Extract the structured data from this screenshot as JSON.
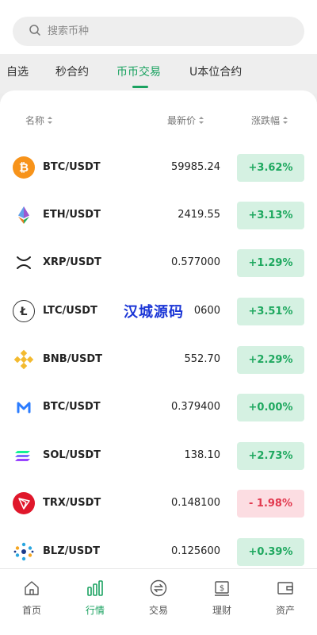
{
  "search": {
    "placeholder": "搜索币种"
  },
  "tabs": [
    {
      "label": "自选"
    },
    {
      "label": "秒合约"
    },
    {
      "label": "币币交易"
    },
    {
      "label": "U本位合约"
    }
  ],
  "active_tab": "币币交易",
  "columns": {
    "name": "名称",
    "price": "最新价",
    "change": "涨跌幅"
  },
  "rows": [
    {
      "pair": "BTC/USDT",
      "price": "59985.24",
      "change": "+3.62%",
      "direction": "up",
      "icon": "bitcoin-icon"
    },
    {
      "pair": "ETH/USDT",
      "price": "2419.55",
      "change": "+3.13%",
      "direction": "up",
      "icon": "ethereum-icon"
    },
    {
      "pair": "XRP/USDT",
      "price": "0.577000",
      "change": "+1.29%",
      "direction": "up",
      "icon": "xrp-icon"
    },
    {
      "pair": "LTC/USDT",
      "price": "0600",
      "change": "+3.51%",
      "direction": "up",
      "icon": "litecoin-icon"
    },
    {
      "pair": "BNB/USDT",
      "price": "552.70",
      "change": "+2.29%",
      "direction": "up",
      "icon": "bnb-icon"
    },
    {
      "pair": "BTC/USDT",
      "price": "0.379400",
      "change": "+0.00%",
      "direction": "up",
      "icon": "m-logo-icon"
    },
    {
      "pair": "SOL/USDT",
      "price": "138.10",
      "change": "+2.73%",
      "direction": "up",
      "icon": "solana-icon"
    },
    {
      "pair": "TRX/USDT",
      "price": "0.148100",
      "change": "- 1.98%",
      "direction": "down",
      "icon": "tron-icon"
    },
    {
      "pair": "BLZ/USDT",
      "price": "0.125600",
      "change": "+0.39%",
      "direction": "up",
      "icon": "bluzelle-icon"
    }
  ],
  "watermark": "汉城源码",
  "nav": [
    {
      "label": "首页",
      "icon": "home-icon"
    },
    {
      "label": "行情",
      "icon": "market-chart-icon"
    },
    {
      "label": "交易",
      "icon": "exchange-icon"
    },
    {
      "label": "理财",
      "icon": "finance-icon"
    },
    {
      "label": "资产",
      "icon": "wallet-icon"
    }
  ],
  "active_nav": "行情",
  "colors": {
    "accent": "#1aa260",
    "up_bg": "#d5f1e2",
    "up_text": "#1ea85f",
    "down_bg": "#fcdde2",
    "down_text": "#e2384e"
  }
}
